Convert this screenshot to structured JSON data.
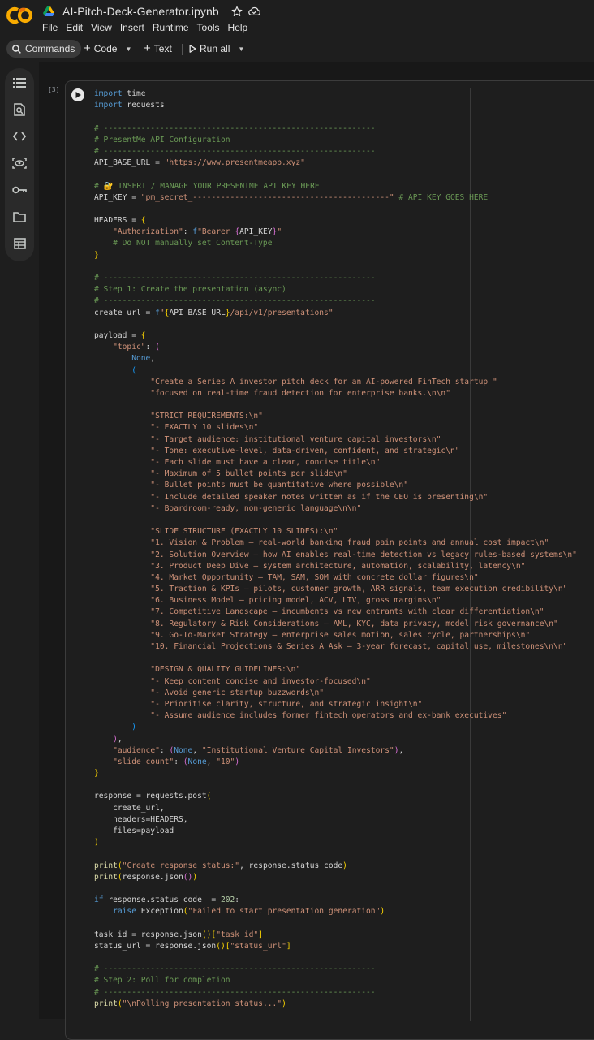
{
  "app": {
    "notebook_title": "AI-Pitch-Deck-Generator.ipynb",
    "menu": [
      "File",
      "Edit",
      "View",
      "Insert",
      "Runtime",
      "Tools",
      "Help"
    ]
  },
  "toolbar": {
    "commands_label": "Commands",
    "code_label": "Code",
    "text_label": "Text",
    "run_all_label": "Run all"
  },
  "sidebar": {
    "icons": [
      "table-of-contents-icon",
      "find-icon",
      "code-snippets-icon",
      "variables-icon",
      "secrets-key-icon",
      "files-folder-icon",
      "data-table-icon"
    ]
  },
  "cell": {
    "execution_count": "[3]",
    "code_lines": [
      [
        [
          "k",
          "import"
        ],
        [
          "p",
          " time"
        ]
      ],
      [
        [
          "k",
          "import"
        ],
        [
          "p",
          " requests"
        ]
      ],
      [],
      [
        [
          "c",
          "# ----------------------------------------------------------"
        ]
      ],
      [
        [
          "c",
          "# PresentMe API Configuration"
        ]
      ],
      [
        [
          "c",
          "# ----------------------------------------------------------"
        ]
      ],
      [
        [
          "p",
          "API_BASE_URL = "
        ],
        [
          "s",
          "\""
        ],
        [
          "su",
          "https://www.presentmeapp.xyz"
        ],
        [
          "s",
          "\""
        ]
      ],
      [],
      [
        [
          "c",
          "# 🔐 INSERT / MANAGE YOUR PRESENTME API KEY HERE"
        ]
      ],
      [
        [
          "p",
          "API_KEY = "
        ],
        [
          "s",
          "\"pm_secret_------------------------------------------\""
        ],
        [
          "c",
          " # API KEY GOES HERE"
        ]
      ],
      [],
      [
        [
          "p",
          "HEADERS = "
        ],
        [
          "b1",
          "{"
        ]
      ],
      [
        [
          "p",
          "    "
        ],
        [
          "s",
          "\"Authorization\""
        ],
        [
          "p",
          ": "
        ],
        [
          "k",
          "f"
        ],
        [
          "s",
          "\"Bearer "
        ],
        [
          "b2",
          "{"
        ],
        [
          "p",
          "API_KEY"
        ],
        [
          "b2",
          "}"
        ],
        [
          "s",
          "\""
        ]
      ],
      [
        [
          "c",
          "    # Do NOT manually set Content-Type"
        ]
      ],
      [
        [
          "b1",
          "}"
        ]
      ],
      [],
      [
        [
          "c",
          "# ----------------------------------------------------------"
        ]
      ],
      [
        [
          "c",
          "# Step 1: Create the presentation (async)"
        ]
      ],
      [
        [
          "c",
          "# ----------------------------------------------------------"
        ]
      ],
      [
        [
          "p",
          "create_url = "
        ],
        [
          "k",
          "f"
        ],
        [
          "s",
          "\""
        ],
        [
          "b1",
          "{"
        ],
        [
          "p",
          "API_BASE_URL"
        ],
        [
          "b1",
          "}"
        ],
        [
          "s",
          "/api/v1/presentations\""
        ]
      ],
      [],
      [
        [
          "p",
          "payload = "
        ],
        [
          "b1",
          "{"
        ]
      ],
      [
        [
          "p",
          "    "
        ],
        [
          "s",
          "\"topic\""
        ],
        [
          "p",
          ": "
        ],
        [
          "b2",
          "("
        ]
      ],
      [
        [
          "p",
          "        "
        ],
        [
          "k",
          "None"
        ],
        [
          "p",
          ","
        ]
      ],
      [
        [
          "p",
          "        "
        ],
        [
          "b3",
          "("
        ]
      ],
      [
        [
          "s",
          "            \"Create a Series A investor pitch deck for an AI-powered FinTech startup \""
        ]
      ],
      [
        [
          "s",
          "            \"focused on real-time fraud detection for enterprise banks.\\n\\n\""
        ]
      ],
      [],
      [
        [
          "s",
          "            \"STRICT REQUIREMENTS:\\n\""
        ]
      ],
      [
        [
          "s",
          "            \"- EXACTLY 10 slides\\n\""
        ]
      ],
      [
        [
          "s",
          "            \"- Target audience: institutional venture capital investors\\n\""
        ]
      ],
      [
        [
          "s",
          "            \"- Tone: executive-level, data-driven, confident, and strategic\\n\""
        ]
      ],
      [
        [
          "s",
          "            \"- Each slide must have a clear, concise title\\n\""
        ]
      ],
      [
        [
          "s",
          "            \"- Maximum of 5 bullet points per slide\\n\""
        ]
      ],
      [
        [
          "s",
          "            \"- Bullet points must be quantitative where possible\\n\""
        ]
      ],
      [
        [
          "s",
          "            \"- Include detailed speaker notes written as if the CEO is presenting\\n\""
        ]
      ],
      [
        [
          "s",
          "            \"- Boardroom-ready, non-generic language\\n\\n\""
        ]
      ],
      [],
      [
        [
          "s",
          "            \"SLIDE STRUCTURE (EXACTLY 10 SLIDES):\\n\""
        ]
      ],
      [
        [
          "s",
          "            \"1. Vision & Problem – real-world banking fraud pain points and annual cost impact\\n\""
        ]
      ],
      [
        [
          "s",
          "            \"2. Solution Overview – how AI enables real-time detection vs legacy rules-based systems\\n\""
        ]
      ],
      [
        [
          "s",
          "            \"3. Product Deep Dive – system architecture, automation, scalability, latency\\n\""
        ]
      ],
      [
        [
          "s",
          "            \"4. Market Opportunity – TAM, SAM, SOM with concrete dollar figures\\n\""
        ]
      ],
      [
        [
          "s",
          "            \"5. Traction & KPIs – pilots, customer growth, ARR signals, team execution credibility\\n\""
        ]
      ],
      [
        [
          "s",
          "            \"6. Business Model – pricing model, ACV, LTV, gross margins\\n\""
        ]
      ],
      [
        [
          "s",
          "            \"7. Competitive Landscape – incumbents vs new entrants with clear differentiation\\n\""
        ]
      ],
      [
        [
          "s",
          "            \"8. Regulatory & Risk Considerations – AML, KYC, data privacy, model risk governance\\n\""
        ]
      ],
      [
        [
          "s",
          "            \"9. Go-To-Market Strategy – enterprise sales motion, sales cycle, partnerships\\n\""
        ]
      ],
      [
        [
          "s",
          "            \"10. Financial Projections & Series A Ask – 3-year forecast, capital use, milestones\\n\\n\""
        ]
      ],
      [],
      [
        [
          "s",
          "            \"DESIGN & QUALITY GUIDELINES:\\n\""
        ]
      ],
      [
        [
          "s",
          "            \"- Keep content concise and investor-focused\\n\""
        ]
      ],
      [
        [
          "s",
          "            \"- Avoid generic startup buzzwords\\n\""
        ]
      ],
      [
        [
          "s",
          "            \"- Prioritise clarity, structure, and strategic insight\\n\""
        ]
      ],
      [
        [
          "s",
          "            \"- Assume audience includes former fintech operators and ex-bank executives\""
        ]
      ],
      [
        [
          "p",
          "        "
        ],
        [
          "b3",
          ")"
        ]
      ],
      [
        [
          "p",
          "    "
        ],
        [
          "b2",
          ")"
        ],
        [
          "p",
          ","
        ]
      ],
      [
        [
          "p",
          "    "
        ],
        [
          "s",
          "\"audience\""
        ],
        [
          "p",
          ": "
        ],
        [
          "b2",
          "("
        ],
        [
          "k",
          "None"
        ],
        [
          "p",
          ", "
        ],
        [
          "s",
          "\"Institutional Venture Capital Investors\""
        ],
        [
          "b2",
          ")"
        ],
        [
          "p",
          ","
        ]
      ],
      [
        [
          "p",
          "    "
        ],
        [
          "s",
          "\"slide_count\""
        ],
        [
          "p",
          ": "
        ],
        [
          "b2",
          "("
        ],
        [
          "k",
          "None"
        ],
        [
          "p",
          ", "
        ],
        [
          "s",
          "\"10\""
        ],
        [
          "b2",
          ")"
        ]
      ],
      [
        [
          "b1",
          "}"
        ]
      ],
      [],
      [
        [
          "p",
          "response = requests.post"
        ],
        [
          "b1",
          "("
        ]
      ],
      [
        [
          "p",
          "    create_url,"
        ]
      ],
      [
        [
          "p",
          "    headers=HEADERS,"
        ]
      ],
      [
        [
          "p",
          "    files=payload"
        ]
      ],
      [
        [
          "b1",
          ")"
        ]
      ],
      [],
      [
        [
          "f",
          "print"
        ],
        [
          "b1",
          "("
        ],
        [
          "s",
          "\"Create response status:\""
        ],
        [
          "p",
          ", response.status_code"
        ],
        [
          "b1",
          ")"
        ]
      ],
      [
        [
          "f",
          "print"
        ],
        [
          "b1",
          "("
        ],
        [
          "p",
          "response.json"
        ],
        [
          "b2",
          "()"
        ],
        [
          "b1",
          ")"
        ]
      ],
      [],
      [
        [
          "k",
          "if"
        ],
        [
          "p",
          " response.status_code != "
        ],
        [
          "n",
          "202"
        ],
        [
          "p",
          ":"
        ]
      ],
      [
        [
          "p",
          "    "
        ],
        [
          "k",
          "raise"
        ],
        [
          "p",
          " Exception"
        ],
        [
          "b1",
          "("
        ],
        [
          "s",
          "\"Failed to start presentation generation\""
        ],
        [
          "b1",
          ")"
        ]
      ],
      [],
      [
        [
          "p",
          "task_id = response.json"
        ],
        [
          "b1",
          "()"
        ],
        [
          "b1",
          "["
        ],
        [
          "s",
          "\"task_id\""
        ],
        [
          "b1",
          "]"
        ]
      ],
      [
        [
          "p",
          "status_url = response.json"
        ],
        [
          "b1",
          "()"
        ],
        [
          "b1",
          "["
        ],
        [
          "s",
          "\"status_url\""
        ],
        [
          "b1",
          "]"
        ]
      ],
      [],
      [
        [
          "c",
          "# ----------------------------------------------------------"
        ]
      ],
      [
        [
          "c",
          "# Step 2: Poll for completion"
        ]
      ],
      [
        [
          "c",
          "# ----------------------------------------------------------"
        ]
      ],
      [
        [
          "f",
          "print"
        ],
        [
          "b1",
          "("
        ],
        [
          "s",
          "\"\\nPolling presentation status...\""
        ],
        [
          "b1",
          ")"
        ]
      ]
    ]
  }
}
